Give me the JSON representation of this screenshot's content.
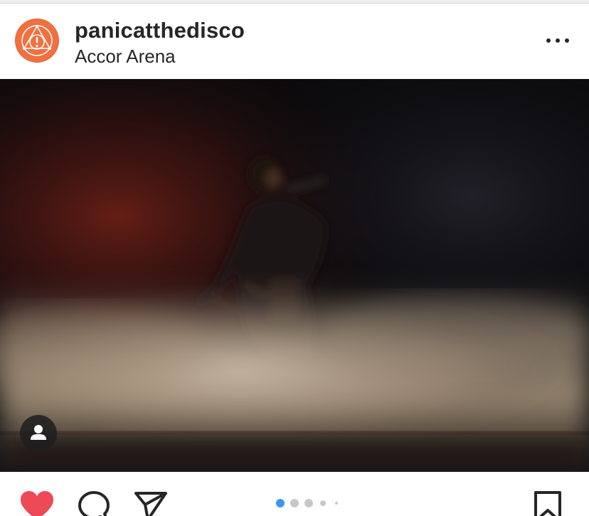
{
  "post": {
    "username": "panicatthedisco",
    "location": "Accor Arena"
  },
  "icons": {
    "avatar": "panic-at-the-disco-logo",
    "more": "more-options-icon",
    "tag": "user-tag-icon",
    "like": "heart-icon",
    "comment": "comment-icon",
    "share": "paper-plane-icon",
    "save": "bookmark-icon"
  },
  "carousel": {
    "total_indicators": 5,
    "active_index": 1
  },
  "colors": {
    "avatar_bg": "#f0703f",
    "like_active": "#ed4956",
    "carousel_active": "#3897f0",
    "carousel_inactive": "#c7c7c7",
    "text": "#262626"
  }
}
